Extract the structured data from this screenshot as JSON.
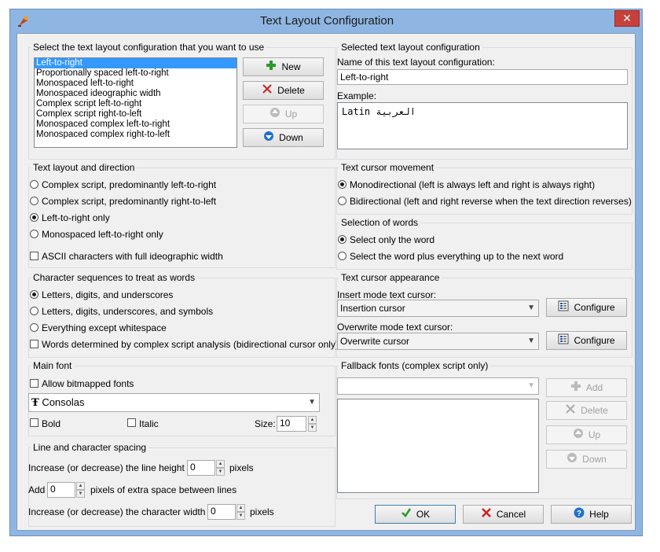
{
  "window": {
    "title": "Text Layout Configuration",
    "close_glyph": "✕"
  },
  "select_group": {
    "label": "Select the text layout configuration that you want to use",
    "items": [
      "Left-to-right",
      "Proportionally spaced left-to-right",
      "Monospaced left-to-right",
      "Monospaced ideographic width",
      "Complex script left-to-right",
      "Complex script right-to-left",
      "Monospaced complex left-to-right",
      "Monospaced complex right-to-left"
    ],
    "selected_index": 0,
    "buttons": {
      "new": "New",
      "delete": "Delete",
      "up": "Up",
      "down": "Down"
    }
  },
  "selected_group": {
    "label": "Selected text layout configuration",
    "name_label": "Name of this text layout configuration:",
    "name_value": "Left-to-right",
    "example_label": "Example:",
    "example_text": "Latin العربية"
  },
  "layout_group": {
    "label": "Text layout and direction",
    "options": [
      "Complex script, predominantly left-to-right",
      "Complex script, predominantly right-to-left",
      "Left-to-right only",
      "Monospaced left-to-right only"
    ],
    "selected_index": 2,
    "ascii_check": "ASCII characters with full ideographic width"
  },
  "cursor_movement": {
    "label": "Text cursor movement",
    "options": [
      "Monodirectional (left is always left and right is always right)",
      "Bidirectional (left and right reverse when the text direction reverses)"
    ],
    "selected_index": 0
  },
  "word_selection": {
    "label": "Selection of words",
    "options": [
      "Select only the word",
      "Select the word plus everything up to the next word"
    ],
    "selected_index": 0
  },
  "char_sequences": {
    "label": "Character sequences to treat as words",
    "options": [
      "Letters, digits, and underscores",
      "Letters, digits, underscores, and symbols",
      "Everything except whitespace"
    ],
    "selected_index": 0,
    "check": "Words determined by complex script analysis (bidirectional cursor only)"
  },
  "cursor_appearance": {
    "label": "Text cursor appearance",
    "insert_label": "Insert mode text cursor:",
    "insert_value": "Insertion cursor",
    "overwrite_label": "Overwrite mode text cursor:",
    "overwrite_value": "Overwrite cursor",
    "configure": "Configure"
  },
  "main_font": {
    "label": "Main font",
    "bitmapped": "Allow bitmapped fonts",
    "font_value": "Consolas",
    "bold": "Bold",
    "italic": "Italic",
    "size_label": "Size:",
    "size_value": "10"
  },
  "fallback": {
    "label": "Fallback fonts (complex script only)",
    "buttons": {
      "add": "Add",
      "delete": "Delete",
      "up": "Up",
      "down": "Down"
    }
  },
  "spacing": {
    "label": "Line and character spacing",
    "line_height_pre": "Increase (or decrease) the line height by",
    "line_height_value": "0",
    "line_height_post": "pixels",
    "add_pre": "Add",
    "add_value": "0",
    "add_post": "pixels of extra space between lines",
    "char_width_pre": "Increase (or decrease) the character width by",
    "char_width_value": "0",
    "char_width_post": "pixels"
  },
  "footer": {
    "ok": "OK",
    "cancel": "Cancel",
    "help": "Help"
  },
  "icons": [
    "app-icon",
    "close-icon",
    "plus-icon",
    "delete-x-icon",
    "arrow-up-icon",
    "arrow-down-icon",
    "configure-icon",
    "font-icon",
    "check-icon",
    "help-icon"
  ],
  "colors": {
    "titlebar": "#8fb6e2",
    "close": "#c7403a",
    "selection": "#3399ff",
    "dialog": "#f0f0f0"
  }
}
